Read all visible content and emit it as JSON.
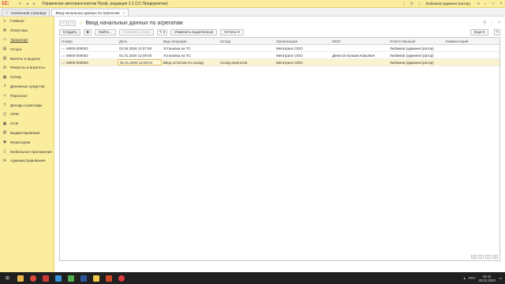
{
  "app": {
    "logo": "1С:",
    "title": "Управление автотранспортом Проф, редакция 2.2  (1С:Предприятие)",
    "user": "Любимов (администратор)"
  },
  "tabs": [
    {
      "label": "Начальная страница"
    },
    {
      "label": "Ввод начальных данных по агрегатам"
    }
  ],
  "sidebar": {
    "items": [
      {
        "label": "Главное",
        "icon": "≡"
      },
      {
        "label": "Логистика",
        "icon": "⌘"
      },
      {
        "label": "Транспорт",
        "icon": "▭"
      },
      {
        "label": "Услуги",
        "icon": "▤"
      },
      {
        "label": "Билеты и выдача",
        "icon": "▥"
      },
      {
        "label": "Ремонты и агрегаты",
        "icon": "⚙"
      },
      {
        "label": "Склад",
        "icon": "▦"
      },
      {
        "label": "Денежные средства",
        "icon": "¤"
      },
      {
        "label": "Персонал",
        "icon": "☺"
      },
      {
        "label": "Доходы и расходы",
        "icon": "±"
      },
      {
        "label": "CRM",
        "icon": "◫"
      },
      {
        "label": "НСИ",
        "icon": "▣"
      },
      {
        "label": "Бюджетирование",
        "icon": "▧"
      },
      {
        "label": "Мониторинг",
        "icon": "◉"
      },
      {
        "label": "Мобильное приложение",
        "icon": "▯"
      },
      {
        "label": "Администрирование",
        "icon": "✲"
      }
    ]
  },
  "header": {
    "back": "←",
    "forward": "→",
    "star": "☆",
    "title": "Ввод начальных данных по агрегатам",
    "link_icon": "🔗",
    "menu_icon": "⋮",
    "close_icon": "×"
  },
  "toolbar": {
    "create": "Создать",
    "copy_icon": "⧉",
    "find": "Найти...",
    "cancel_search": "Отменить поиск",
    "mode_icon": "✎ ▾",
    "change_selected": "Изменить выделенные",
    "reports": "Отчеты ▾",
    "more": "Еще ▾",
    "help": "?"
  },
  "table": {
    "columns": [
      "Номер",
      "Дата",
      "Вид операции",
      "Склад",
      "Организация",
      "МОЛ",
      "Ответственный",
      "Комментарий"
    ],
    "rows": [
      {
        "number": "М000-000001",
        "date": "02.05.2018 11:07:58",
        "operation": "Установка на ТС",
        "warehouse": "",
        "organization": "Мегатранс ООО",
        "mol": "",
        "responsible": "Любимов (администратор)",
        "comment": ""
      },
      {
        "number": "М000-000002",
        "date": "01.01.2020 12:00:00",
        "operation": "Установка на ТС",
        "warehouse": "",
        "organization": "Мегатранс ООО",
        "mol": "Денисов Кузьма Юрьевич",
        "responsible": "Любимов (администратор)",
        "comment": ""
      },
      {
        "number": "М000-000003",
        "date": "01.01.2020 12:00:01",
        "operation": "Ввод остатков по складу",
        "warehouse": "Склад агрегатов",
        "organization": "Мегатранс ООО",
        "mol": "",
        "responsible": "Любимов (администратор)",
        "comment": ""
      }
    ]
  },
  "pager": {
    "first": "«",
    "prev": "‹",
    "next": "›",
    "last": "»"
  },
  "taskbar": {
    "start_icon": "⊞",
    "time": "18:41",
    "date": "20.02.2020",
    "lang": "РУС"
  }
}
